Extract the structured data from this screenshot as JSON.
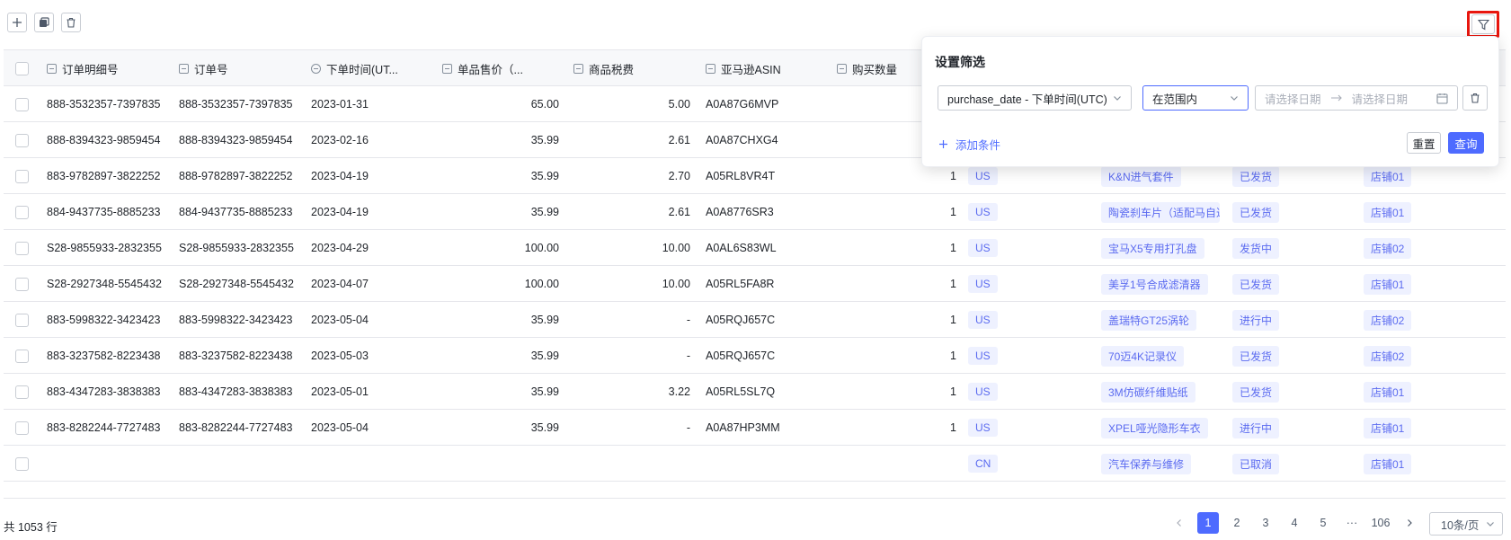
{
  "toolbar": {
    "add_icon": "plus-icon",
    "copy_icon": "copy-icon",
    "delete_icon": "trash-icon"
  },
  "filter_icon": "filter-icon",
  "table": {
    "headers": [
      "订单明细号",
      "订单号",
      "下单时间(UT...",
      "单品售价（...",
      "商品税费",
      "亚马逊ASIN",
      "购买数量"
    ],
    "rows": [
      {
        "detail_no": "888-3532357-7397835",
        "order_no": "888-3532357-7397835",
        "date": "2023-01-31",
        "price": "65.00",
        "tax": "5.00",
        "asin": "A0A87G6MVP",
        "qty": "",
        "country": "",
        "product": "",
        "status": "",
        "store": ""
      },
      {
        "detail_no": "888-8394323-9859454",
        "order_no": "888-8394323-9859454",
        "date": "2023-02-16",
        "price": "35.99",
        "tax": "2.61",
        "asin": "A0A87CHXG4",
        "qty": "",
        "country": "",
        "product": "",
        "status": "",
        "store": ""
      },
      {
        "detail_no": "883-9782897-3822252",
        "order_no": "888-9782897-3822252",
        "date": "2023-04-19",
        "price": "35.99",
        "tax": "2.70",
        "asin": "A05RL8VR4T",
        "qty": "1",
        "country": "US",
        "product": "K&N进气套件",
        "status": "已发货",
        "store": "店铺01"
      },
      {
        "detail_no": "884-9437735-8885233",
        "order_no": "884-9437735-8885233",
        "date": "2023-04-19",
        "price": "35.99",
        "tax": "2.61",
        "asin": "A0A8776SR3",
        "qty": "1",
        "country": "US",
        "product": "陶瓷刹车片（适配马自达",
        "status": "已发货",
        "store": "店铺01"
      },
      {
        "detail_no": "S28-9855933-2832355",
        "order_no": "S28-9855933-2832355",
        "date": "2023-04-29",
        "price": "100.00",
        "tax": "10.00",
        "asin": "A0AL6S83WL",
        "qty": "1",
        "country": "US",
        "product": "宝马X5专用打孔盘",
        "status": "发货中",
        "store": "店铺02"
      },
      {
        "detail_no": "S28-2927348-5545432",
        "order_no": "S28-2927348-5545432",
        "date": "2023-04-07",
        "price": "100.00",
        "tax": "10.00",
        "asin": "A05RL5FA8R",
        "qty": "1",
        "country": "US",
        "product": "美孚1号合成滤清器",
        "status": "已发货",
        "store": "店铺01"
      },
      {
        "detail_no": "883-5998322-3423423",
        "order_no": "883-5998322-3423423",
        "date": "2023-05-04",
        "price": "35.99",
        "tax": "-",
        "asin": "A05RQJ657C",
        "qty": "1",
        "country": "US",
        "product": "盖瑞特GT25涡轮",
        "status": "进行中",
        "store": "店铺02"
      },
      {
        "detail_no": "883-3237582-8223438",
        "order_no": "883-3237582-8223438",
        "date": "2023-05-03",
        "price": "35.99",
        "tax": "-",
        "asin": "A05RQJ657C",
        "qty": "1",
        "country": "US",
        "product": "70迈4K记录仪",
        "status": "已发货",
        "store": "店铺02"
      },
      {
        "detail_no": "883-4347283-3838383",
        "order_no": "883-4347283-3838383",
        "date": "2023-05-01",
        "price": "35.99",
        "tax": "3.22",
        "asin": "A05RL5SL7Q",
        "qty": "1",
        "country": "US",
        "product": "3M仿碳纤维贴纸",
        "status": "已发货",
        "store": "店铺01"
      },
      {
        "detail_no": "883-8282244-7727483",
        "order_no": "883-8282244-7727483",
        "date": "2023-05-04",
        "price": "35.99",
        "tax": "-",
        "asin": "A0A87HP3MM",
        "qty": "1",
        "country": "US",
        "product": "XPEL哑光隐形车衣",
        "status": "进行中",
        "store": "店铺01"
      },
      {
        "detail_no": "",
        "order_no": "",
        "date": "",
        "price": "",
        "tax": "",
        "asin": "",
        "qty": "",
        "country": "CN",
        "product": "汽车保养与维修",
        "status": "已取消",
        "store": "店铺01"
      }
    ]
  },
  "footer": {
    "total": "共 1053 行",
    "pages": [
      "1",
      "2",
      "3",
      "4",
      "5",
      "···",
      "106"
    ],
    "current_page": "1",
    "page_size": "10条/页"
  },
  "filter_popup": {
    "title": "设置筛选",
    "field": "purchase_date - 下单时间(UTC)",
    "operator": "在范围内",
    "start_placeholder": "请选择日期",
    "end_placeholder": "请选择日期",
    "add_condition": "添加条件",
    "reset": "重置",
    "query": "查询"
  },
  "colors": {
    "accent": "#4e6bff",
    "tag_bg": "#eef1ff",
    "highlight_border": "#e8160e"
  }
}
